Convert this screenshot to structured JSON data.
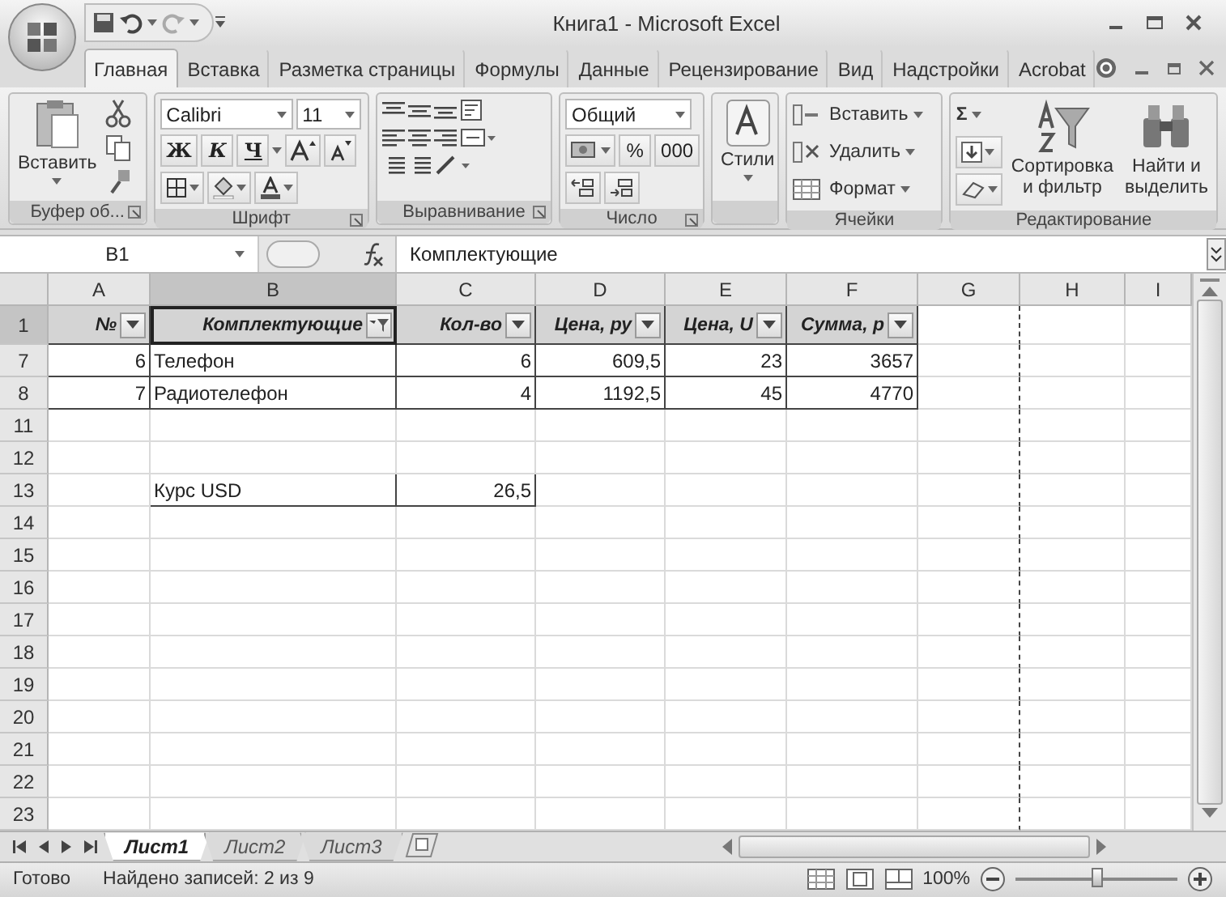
{
  "window": {
    "title": "Книга1 - Microsoft Excel"
  },
  "tabs": [
    {
      "label": "Главная",
      "selected": true
    },
    {
      "label": "Вставка",
      "selected": false
    },
    {
      "label": "Разметка страницы",
      "selected": false
    },
    {
      "label": "Формулы",
      "selected": false
    },
    {
      "label": "Данные",
      "selected": false
    },
    {
      "label": "Рецензирование",
      "selected": false
    },
    {
      "label": "Вид",
      "selected": false
    },
    {
      "label": "Надстройки",
      "selected": false
    },
    {
      "label": "Acrobat",
      "selected": false
    }
  ],
  "ribbon": {
    "clipboard": {
      "label": "Буфер об...",
      "paste": "Вставить"
    },
    "font": {
      "label": "Шрифт",
      "font_name": "Calibri",
      "font_size": "11",
      "bold": "Ж",
      "italic": "К",
      "underline": "Ч"
    },
    "alignment": {
      "label": "Выравнивание"
    },
    "number": {
      "label": "Число",
      "format": "Общий",
      "percent": "%",
      "thousands": "000"
    },
    "styles": {
      "label": "Стили"
    },
    "cells": {
      "label": "Ячейки",
      "insert": "Вставить",
      "delete": "Удалить",
      "format": "Формат"
    },
    "editing": {
      "label": "Редактирование",
      "sum": "Σ",
      "sort": "Сортировка и фильтр",
      "find": "Найти и выделить"
    }
  },
  "formula_bar": {
    "name_box": "B1",
    "value": "Комплектующие"
  },
  "grid": {
    "columns": [
      {
        "label": "A",
        "selected": false,
        "filtered": false
      },
      {
        "label": "B",
        "selected": true,
        "filtered": true
      },
      {
        "label": "C",
        "selected": false,
        "filtered": false
      },
      {
        "label": "D",
        "selected": false,
        "filtered": false
      },
      {
        "label": "E",
        "selected": false,
        "filtered": false
      },
      {
        "label": "F",
        "selected": false,
        "filtered": false
      },
      {
        "label": "G",
        "selected": false
      },
      {
        "label": "H",
        "selected": false
      },
      {
        "label": "I",
        "selected": false
      }
    ],
    "rows": [
      {
        "header": "1",
        "selected": true,
        "kind": "header",
        "cells": [
          "№",
          "Комплектующие",
          "Кол-во",
          "Цена, ру",
          "Цена, U",
          "Сумма, р"
        ]
      },
      {
        "header": "7",
        "selected": false,
        "kind": "data",
        "cells": [
          "6",
          "Телефон",
          "6",
          "609,5",
          "23",
          "3657"
        ]
      },
      {
        "header": "8",
        "selected": false,
        "kind": "data",
        "cells": [
          "7",
          "Радиотелефон",
          "4",
          "1192,5",
          "45",
          "4770"
        ]
      },
      {
        "header": "11",
        "selected": false,
        "kind": "data",
        "cells": []
      },
      {
        "header": "12",
        "selected": false,
        "kind": "data",
        "cells": []
      },
      {
        "header": "13",
        "selected": false,
        "kind": "data",
        "cells": [
          null,
          "Курс USD",
          "26,5"
        ]
      },
      {
        "header": "14",
        "selected": false,
        "kind": "data",
        "cells": []
      },
      {
        "header": "15",
        "selected": false,
        "kind": "data",
        "cells": []
      },
      {
        "header": "16",
        "selected": false,
        "kind": "data",
        "cells": []
      },
      {
        "header": "17",
        "selected": false,
        "kind": "data",
        "cells": []
      },
      {
        "header": "18",
        "selected": false,
        "kind": "data",
        "cells": []
      },
      {
        "header": "19",
        "selected": false,
        "kind": "data",
        "cells": []
      },
      {
        "header": "20",
        "selected": false,
        "kind": "data",
        "cells": []
      },
      {
        "header": "21",
        "selected": false,
        "kind": "data",
        "cells": []
      },
      {
        "header": "22",
        "selected": false,
        "kind": "data",
        "cells": []
      },
      {
        "header": "23",
        "selected": false,
        "kind": "data",
        "cells": []
      }
    ]
  },
  "sheets": [
    {
      "label": "Лист1",
      "selected": true
    },
    {
      "label": "Лист2",
      "selected": false
    },
    {
      "label": "Лист3",
      "selected": false
    }
  ],
  "status_bar": {
    "state": "Готово",
    "info": "Найдено записей: 2 из 9",
    "zoom": "100%",
    "zoom_level": {
      "level": 0.5
    }
  }
}
